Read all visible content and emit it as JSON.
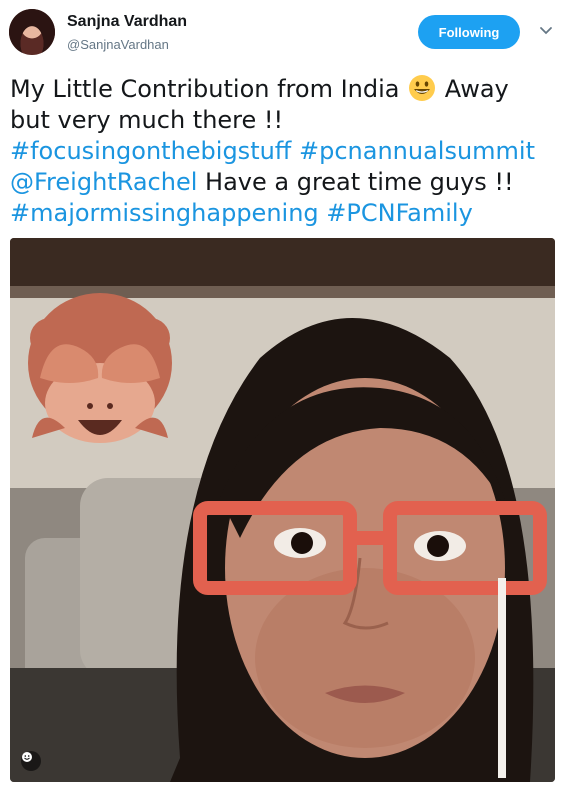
{
  "user": {
    "name": "Sanjna Vardhan",
    "handle": "@SanjnaVardhan"
  },
  "follow": {
    "label": "Following"
  },
  "tweet": {
    "line1_text": "My Little Contribution from India",
    "line1_after_emoji": "Away",
    "line2": "but very much there !!",
    "hashtag1": "#focusingonthebigstuff",
    "hashtag2": "#pcnannualsummit",
    "mention": "@FreightRachel",
    "mention_after": " Have a great time guys !!",
    "hashtag3": "#majormissinghappening",
    "hashtag4": "#PCNFamily"
  },
  "icons": {
    "emoji": "grinning-face-emoji-icon",
    "chevron": "chevron-down-icon",
    "monkey": "see-no-evil-monkey-icon",
    "badge": "emoji-badge-icon"
  },
  "colors": {
    "accent": "#1da1f2",
    "link": "#1b95e0",
    "text": "#14171a",
    "muted": "#657786"
  }
}
